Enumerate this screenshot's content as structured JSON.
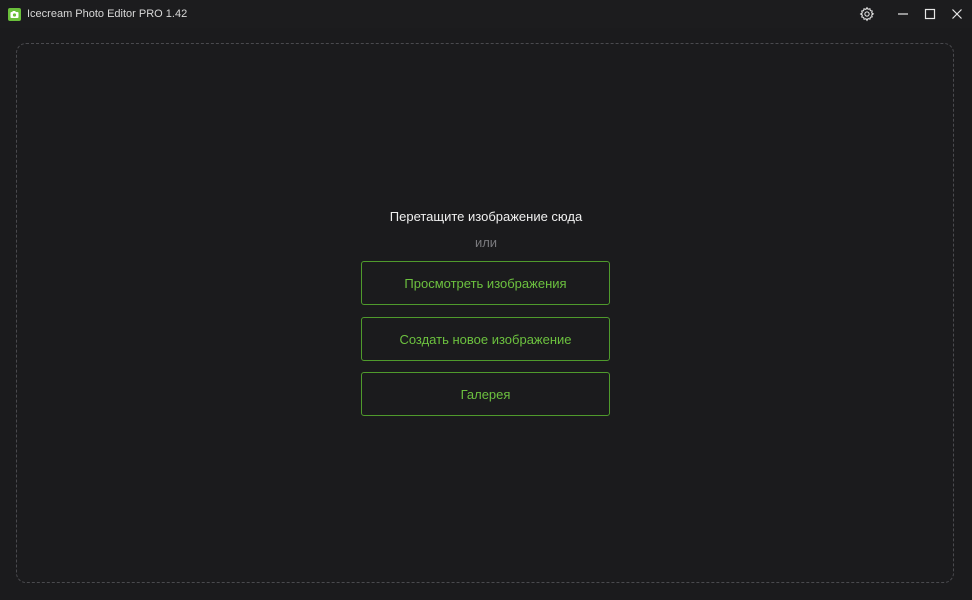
{
  "window": {
    "title": "Icecream Photo Editor PRO 1.42",
    "app_icon": "camera-icon",
    "controls": [
      "settings-icon",
      "minimize-icon",
      "maximize-icon",
      "close-icon"
    ]
  },
  "dropzone": {
    "prompt": "Перетащите изображение сюда",
    "or_label": "или",
    "buttons": [
      {
        "label": "Просмотреть изображения"
      },
      {
        "label": "Создать новое изображение"
      },
      {
        "label": "Галерея"
      }
    ]
  },
  "colors": {
    "background": "#1b1b1d",
    "accent": "#6cc13f",
    "accent_border": "#4f9a2c"
  }
}
